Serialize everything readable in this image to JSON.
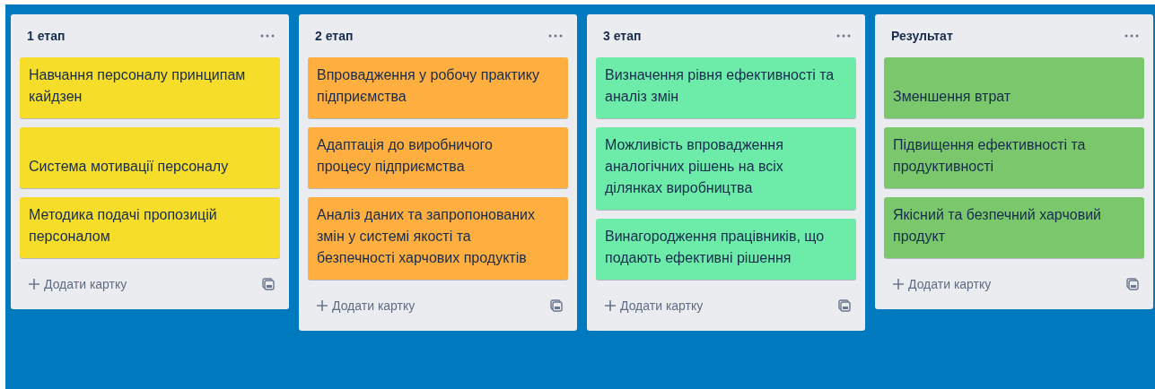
{
  "lists": [
    {
      "title": "1 етап",
      "color": "#f5dd29",
      "cards": [
        {
          "text": "Навчання персоналу принципам кайдзен",
          "blank_first_line": false
        },
        {
          "text": "Система мотивації персоналу",
          "blank_first_line": true
        },
        {
          "text": "Методика подачі пропозицій персоналом",
          "blank_first_line": false
        }
      ],
      "add_label": "Додати картку"
    },
    {
      "title": "2 етап",
      "color": "#ffaf3f",
      "cards": [
        {
          "text": "Впровадження у робочу практику підприємства",
          "blank_first_line": false
        },
        {
          "text": "Адаптація до виробничого процесу підприємства",
          "blank_first_line": false
        },
        {
          "text": "Аналіз даних та запропонованих змін у системі якості та безпечності харчових продуктів",
          "blank_first_line": false
        }
      ],
      "add_label": "Додати картку"
    },
    {
      "title": "3 етап",
      "color": "#6deca9",
      "cards": [
        {
          "text": "Визначення рівня ефективності та аналіз змін",
          "blank_first_line": false
        },
        {
          "text": "Можливість впровадження аналогічних рішень на всіх ділянках виробництва",
          "blank_first_line": false
        },
        {
          "text": "Винагородження працівників, що подають ефективні рішення",
          "blank_first_line": false
        }
      ],
      "add_label": "Додати картку"
    },
    {
      "title": "Результат",
      "color": "#7bc86c",
      "cards": [
        {
          "text": "Зменшення втрат",
          "blank_first_line": true
        },
        {
          "text": "Підвищення ефективності та продуктивності",
          "blank_first_line": false
        },
        {
          "text": "Якісний та безпечний харчовий продукт",
          "blank_first_line": false
        }
      ],
      "add_label": "Додати картку"
    }
  ]
}
